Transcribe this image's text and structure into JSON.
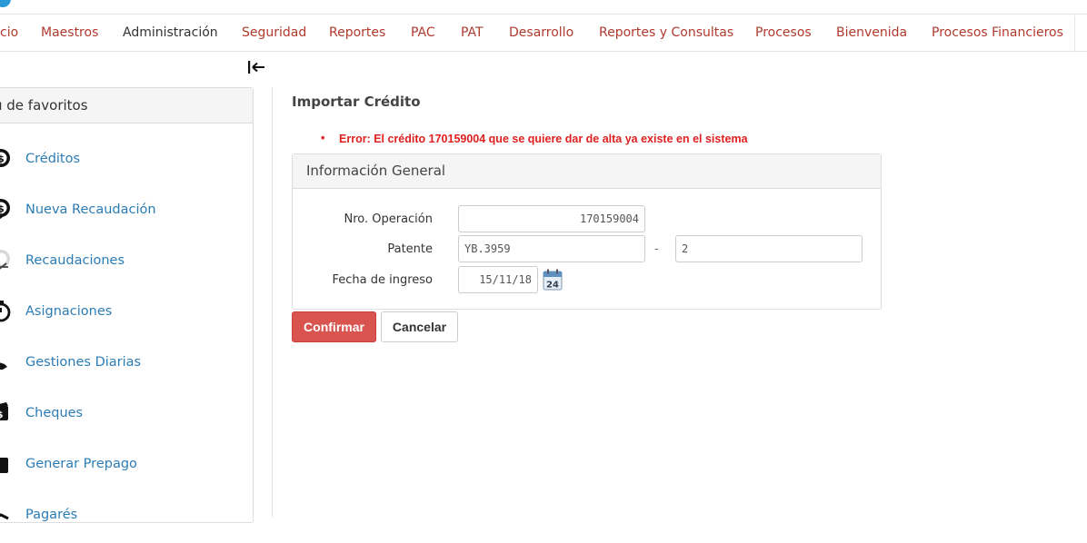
{
  "nav": {
    "items": [
      {
        "label": "cio",
        "color": "#b03a2e"
      },
      {
        "label": "Maestros",
        "color": "#b03a2e"
      },
      {
        "label": "Administración",
        "color": "#333333"
      },
      {
        "label": "Seguridad",
        "color": "#b03a2e"
      },
      {
        "label": "Reportes",
        "color": "#b03a2e"
      },
      {
        "label": "PAC",
        "color": "#b03a2e"
      },
      {
        "label": "PAT",
        "color": "#b03a2e"
      },
      {
        "label": "Desarrollo",
        "color": "#b03a2e"
      },
      {
        "label": "Reportes y Consultas",
        "color": "#b03a2e"
      },
      {
        "label": "Procesos",
        "color": "#b03a2e"
      },
      {
        "label": "Bienvenida",
        "color": "#b03a2e"
      },
      {
        "label": "Procesos Financieros",
        "color": "#b03a2e"
      }
    ]
  },
  "sidebar": {
    "title": "ú de favoritos",
    "collapse_icon": "collapse-left-icon",
    "items": [
      {
        "label": "Créditos",
        "icon": "dollar-coin-icon"
      },
      {
        "label": "Nueva Recaudación",
        "icon": "dollar-edit-icon"
      },
      {
        "label": "Recaudaciones",
        "icon": "dollar-list-icon"
      },
      {
        "label": "Asignaciones",
        "icon": "stopwatch-icon"
      },
      {
        "label": "Gestiones Diarias",
        "icon": "handshake-icon"
      },
      {
        "label": "Cheques",
        "icon": "cheque-icon"
      },
      {
        "label": "Generar Prepago",
        "icon": "wallet-icon"
      },
      {
        "label": "Pagarés",
        "icon": "document-icon"
      }
    ]
  },
  "main": {
    "title": "Importar Crédito",
    "error": "Error: El crédito 170159004 que se quiere dar de alta ya existe en el sistema",
    "panel": {
      "title": "Información General",
      "fields": {
        "operacion_label": "Nro. Operación",
        "operacion_value": "170159004",
        "patente_label": "Patente",
        "patente_value": "YB.3959",
        "patente_sep": "-",
        "patente_dv": "2",
        "fecha_label": "Fecha de ingreso",
        "fecha_value": "15/11/18",
        "calendar_day": "24"
      }
    },
    "buttons": {
      "confirm": "Confirmar",
      "cancel": "Cancelar"
    }
  },
  "colors": {
    "accent_red": "#d9534f",
    "nav_red": "#b03a2e",
    "link_blue": "#2b7cb5",
    "error_red": "#e02020"
  }
}
